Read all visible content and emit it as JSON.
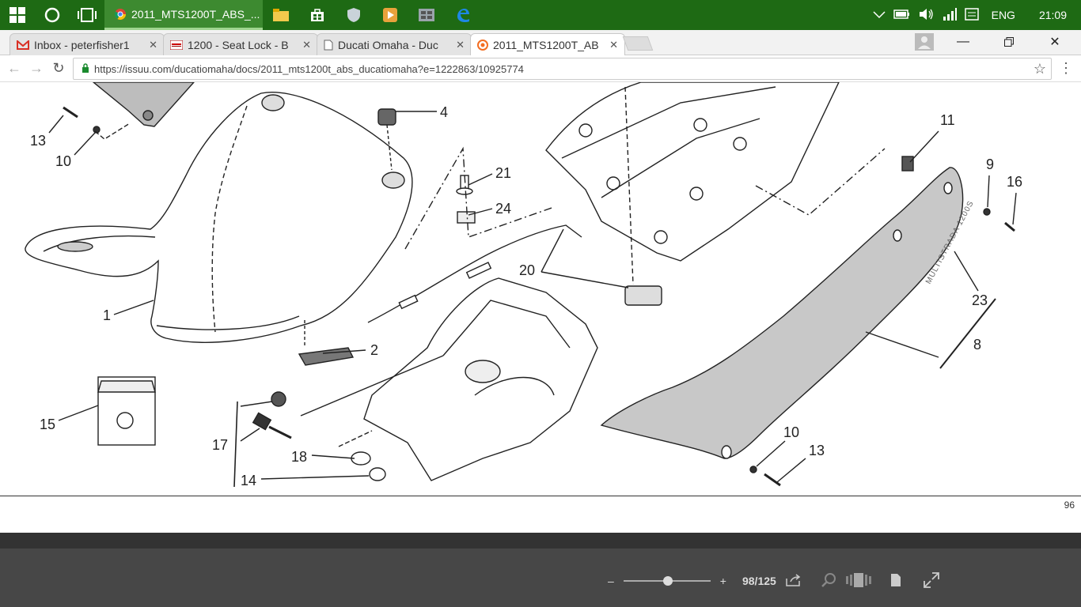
{
  "taskbar": {
    "active_app_label": "2011_MTS1200T_ABS_...",
    "language": "ENG",
    "clock": "21:09"
  },
  "tabs": [
    {
      "label": "Inbox - peterfisher1",
      "icon": "gmail-icon"
    },
    {
      "label": "1200 - Seat Lock - B",
      "icon": "forum-icon"
    },
    {
      "label": "Ducati Omaha - Duc",
      "icon": "page-icon"
    },
    {
      "label": "2011_MTS1200T_AB",
      "icon": "issuu-icon",
      "active": true
    }
  ],
  "address": {
    "url": "https://issuu.com/ducatiomaha/docs/2011_mts1200t_abs_ducatiomaha?e=1222863/10925774"
  },
  "diagram": {
    "callouts": [
      "13",
      "10",
      "4",
      "21",
      "24",
      "11",
      "9",
      "16",
      "1",
      "20",
      "23",
      "8",
      "2",
      "15",
      "17",
      "18",
      "14",
      "10",
      "13"
    ],
    "brand_text": "MULTISTRADA 1200S"
  },
  "page": {
    "number": "96"
  },
  "viewer": {
    "zoom_minus": "–",
    "zoom_plus": "+",
    "page_counter": "98/125"
  },
  "colors": {
    "taskbar": "#1e6a14",
    "viewer_bar": "#474747"
  }
}
